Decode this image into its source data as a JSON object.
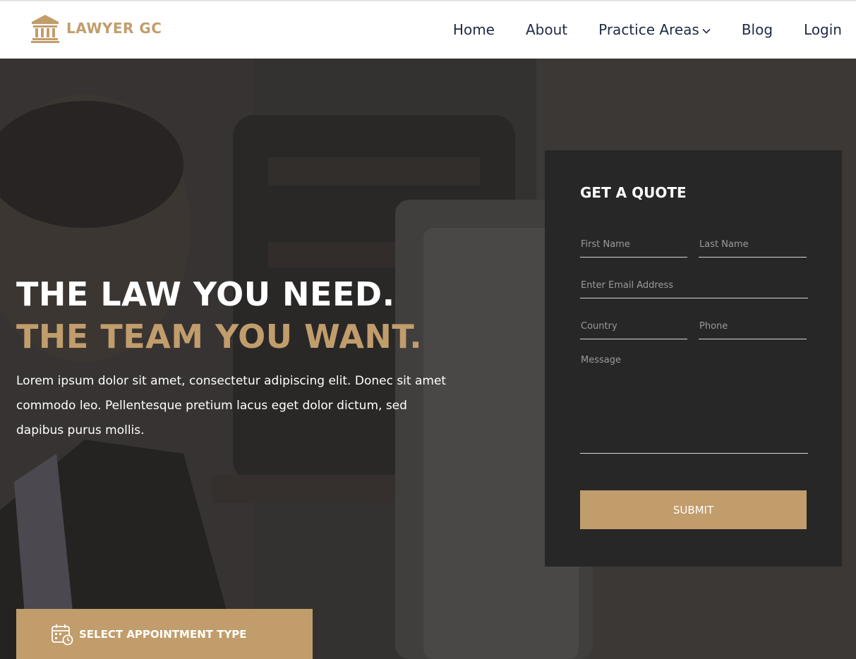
{
  "brand": {
    "name": "LAWYER GC",
    "accent_color": "#c19d6c",
    "icon": "courthouse-icon"
  },
  "nav": {
    "items": [
      {
        "label": "Home"
      },
      {
        "label": "About"
      },
      {
        "label": "Practice Areas",
        "icon": "chevron-down-icon"
      },
      {
        "label": "Blog"
      },
      {
        "label": "Login"
      }
    ]
  },
  "hero": {
    "title_line1": "THE LAW YOU NEED.",
    "title_line2": "THE TEAM YOU WANT.",
    "body": "Lorem ipsum dolor sit amet, consectetur adipiscing elit. Donec sit amet commodo leo. Pellentesque pretium lacus eget dolor dictum, sed dapibus purus mollis."
  },
  "quote_form": {
    "title": "GET A QUOTE",
    "first_name_placeholder": "First Name",
    "last_name_placeholder": "Last Name",
    "email_placeholder": "Enter Email Address",
    "country_placeholder": "Country",
    "phone_placeholder": "Phone",
    "message_placeholder": "Message",
    "submit_label": "SUBMIT"
  },
  "appointment": {
    "label": "SELECT APPOINTMENT TYPE",
    "icon": "calendar-clock-icon"
  },
  "colors": {
    "nav_text": "#1f2a44",
    "form_bg": "#272727",
    "hero_overlay": "#3a3837"
  }
}
